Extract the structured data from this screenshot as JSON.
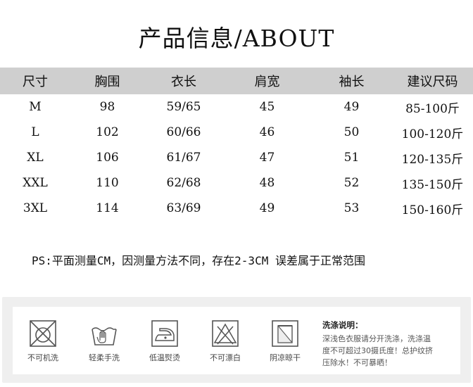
{
  "title": "产品信息/ABOUT",
  "table": {
    "headers": [
      "尺寸",
      "胸围",
      "衣长",
      "肩宽",
      "袖长",
      "建议尺码"
    ],
    "rows": [
      [
        "M",
        "98",
        "59/65",
        "45",
        "49",
        "85-100斤"
      ],
      [
        "L",
        "102",
        "60/66",
        "46",
        "50",
        "100-120斤"
      ],
      [
        "XL",
        "106",
        "61/67",
        "47",
        "51",
        "120-135斤"
      ],
      [
        "XXL",
        "110",
        "62/68",
        "48",
        "52",
        "135-150斤"
      ],
      [
        "3XL",
        "114",
        "63/69",
        "49",
        "53",
        "150-160斤"
      ]
    ]
  },
  "note": "PS:平面测量CM，因测量方法不同，存在2-3CM 误差属于正常范围",
  "care": {
    "items": [
      {
        "icon": "no-machine-wash-icon",
        "label": "不可机洗"
      },
      {
        "icon": "hand-wash-icon",
        "label": "轻柔手洗"
      },
      {
        "icon": "low-temp-iron-icon",
        "label": "低温熨烫"
      },
      {
        "icon": "no-bleach-icon",
        "label": "不可漂白"
      },
      {
        "icon": "shade-dry-icon",
        "label": "阴凉晾干"
      }
    ],
    "desc_title": "洗涤说明：",
    "desc_lines": [
      "深浅色衣服请分开洗涤，洗涤温",
      "度不可超过30摄氏度！总护纹挤",
      "压除水！不可暴晒！"
    ]
  },
  "colors": {
    "header_bg": "#cfcfcf",
    "panel_bg": "#efefef",
    "icon_stroke": "#555555"
  }
}
